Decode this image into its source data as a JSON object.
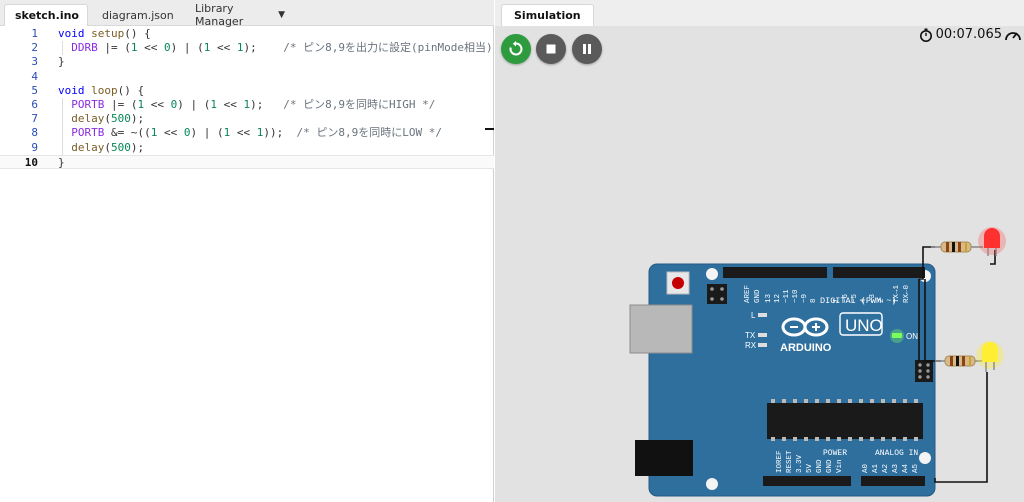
{
  "editor": {
    "tabs": [
      {
        "label": "sketch.ino",
        "modified": true,
        "active": true
      },
      {
        "label": "diagram.json",
        "modified": true,
        "active": false
      },
      {
        "label": "Library Manager",
        "dropdown": true,
        "active": false
      }
    ],
    "current_line": 10,
    "lines": [
      {
        "n": "1",
        "tokens": [
          [
            "kw",
            "void "
          ],
          [
            "fn",
            "setup"
          ],
          [
            "op",
            "() {"
          ]
        ]
      },
      {
        "n": "2",
        "tokens": [
          [
            "op",
            "  "
          ],
          [
            "mac",
            "DDRB"
          ],
          [
            "op",
            " |= ("
          ],
          [
            "num",
            "1"
          ],
          [
            "op",
            " << "
          ],
          [
            "num",
            "0"
          ],
          [
            "op",
            ") | ("
          ],
          [
            "num",
            "1"
          ],
          [
            "op",
            " << "
          ],
          [
            "num",
            "1"
          ],
          [
            "op",
            ");    "
          ],
          [
            "cm",
            "/* ピン8,9を出力に設定(pinMode相当) */"
          ]
        ]
      },
      {
        "n": "3",
        "tokens": [
          [
            "op",
            "}"
          ]
        ]
      },
      {
        "n": "4",
        "tokens": []
      },
      {
        "n": "5",
        "tokens": [
          [
            "kw",
            "void "
          ],
          [
            "fn",
            "loop"
          ],
          [
            "op",
            "() {"
          ]
        ]
      },
      {
        "n": "6",
        "tokens": [
          [
            "op",
            "  "
          ],
          [
            "mac",
            "PORTB"
          ],
          [
            "op",
            " |= ("
          ],
          [
            "num",
            "1"
          ],
          [
            "op",
            " << "
          ],
          [
            "num",
            "0"
          ],
          [
            "op",
            ") | ("
          ],
          [
            "num",
            "1"
          ],
          [
            "op",
            " << "
          ],
          [
            "num",
            "1"
          ],
          [
            "op",
            ");   "
          ],
          [
            "cm",
            "/* ピン8,9を同時にHIGH */"
          ]
        ]
      },
      {
        "n": "7",
        "tokens": [
          [
            "op",
            "  "
          ],
          [
            "fn",
            "delay"
          ],
          [
            "op",
            "("
          ],
          [
            "num",
            "500"
          ],
          [
            "op",
            ");"
          ]
        ]
      },
      {
        "n": "8",
        "tokens": [
          [
            "op",
            "  "
          ],
          [
            "mac",
            "PORTB"
          ],
          [
            "op",
            " &= ~(("
          ],
          [
            "num",
            "1"
          ],
          [
            "op",
            " << "
          ],
          [
            "num",
            "0"
          ],
          [
            "op",
            ") | ("
          ],
          [
            "num",
            "1"
          ],
          [
            "op",
            " << "
          ],
          [
            "num",
            "1"
          ],
          [
            "op",
            "));  "
          ],
          [
            "cm",
            "/* ピン8,9を同時にLOW */"
          ]
        ]
      },
      {
        "n": "9",
        "tokens": [
          [
            "op",
            "  "
          ],
          [
            "fn",
            "delay"
          ],
          [
            "op",
            "("
          ],
          [
            "num",
            "500"
          ],
          [
            "op",
            ");"
          ]
        ]
      },
      {
        "n": "10",
        "tokens": [
          [
            "op",
            "}"
          ]
        ]
      }
    ]
  },
  "simulation": {
    "tab_label": "Simulation",
    "timer": "00:07.065",
    "controls": {
      "restart": "restart",
      "stop": "stop",
      "pause": "pause"
    },
    "board": {
      "logo_text": "ARDUINO",
      "model": "UNO",
      "on_label": "ON",
      "l_label": "L",
      "tx_label": "TX",
      "rx_label": "RX",
      "digital_label": "DIGITAL (PWM ~)",
      "power_label": "POWER",
      "analog_label": "ANALOG IN",
      "top_pins": [
        "AREF",
        "GND",
        "13",
        "12",
        "~11",
        "~10",
        "~9",
        "8",
        "7",
        "~6",
        "~5",
        "4",
        "~3",
        "2",
        "TX→1",
        "RX←0"
      ],
      "power_pins": [
        "IOREF",
        "RESET",
        "3.3V",
        "5V",
        "GND",
        "GND",
        "Vin"
      ],
      "analog_pins": [
        "A0",
        "A1",
        "A2",
        "A3",
        "A4",
        "A5"
      ]
    },
    "colors": {
      "board": "#2f6f9e",
      "led_red": "#ff3030",
      "led_yellow": "#ffee33",
      "power_led": "#7cff5c",
      "restart": "#2e9b3e"
    }
  }
}
